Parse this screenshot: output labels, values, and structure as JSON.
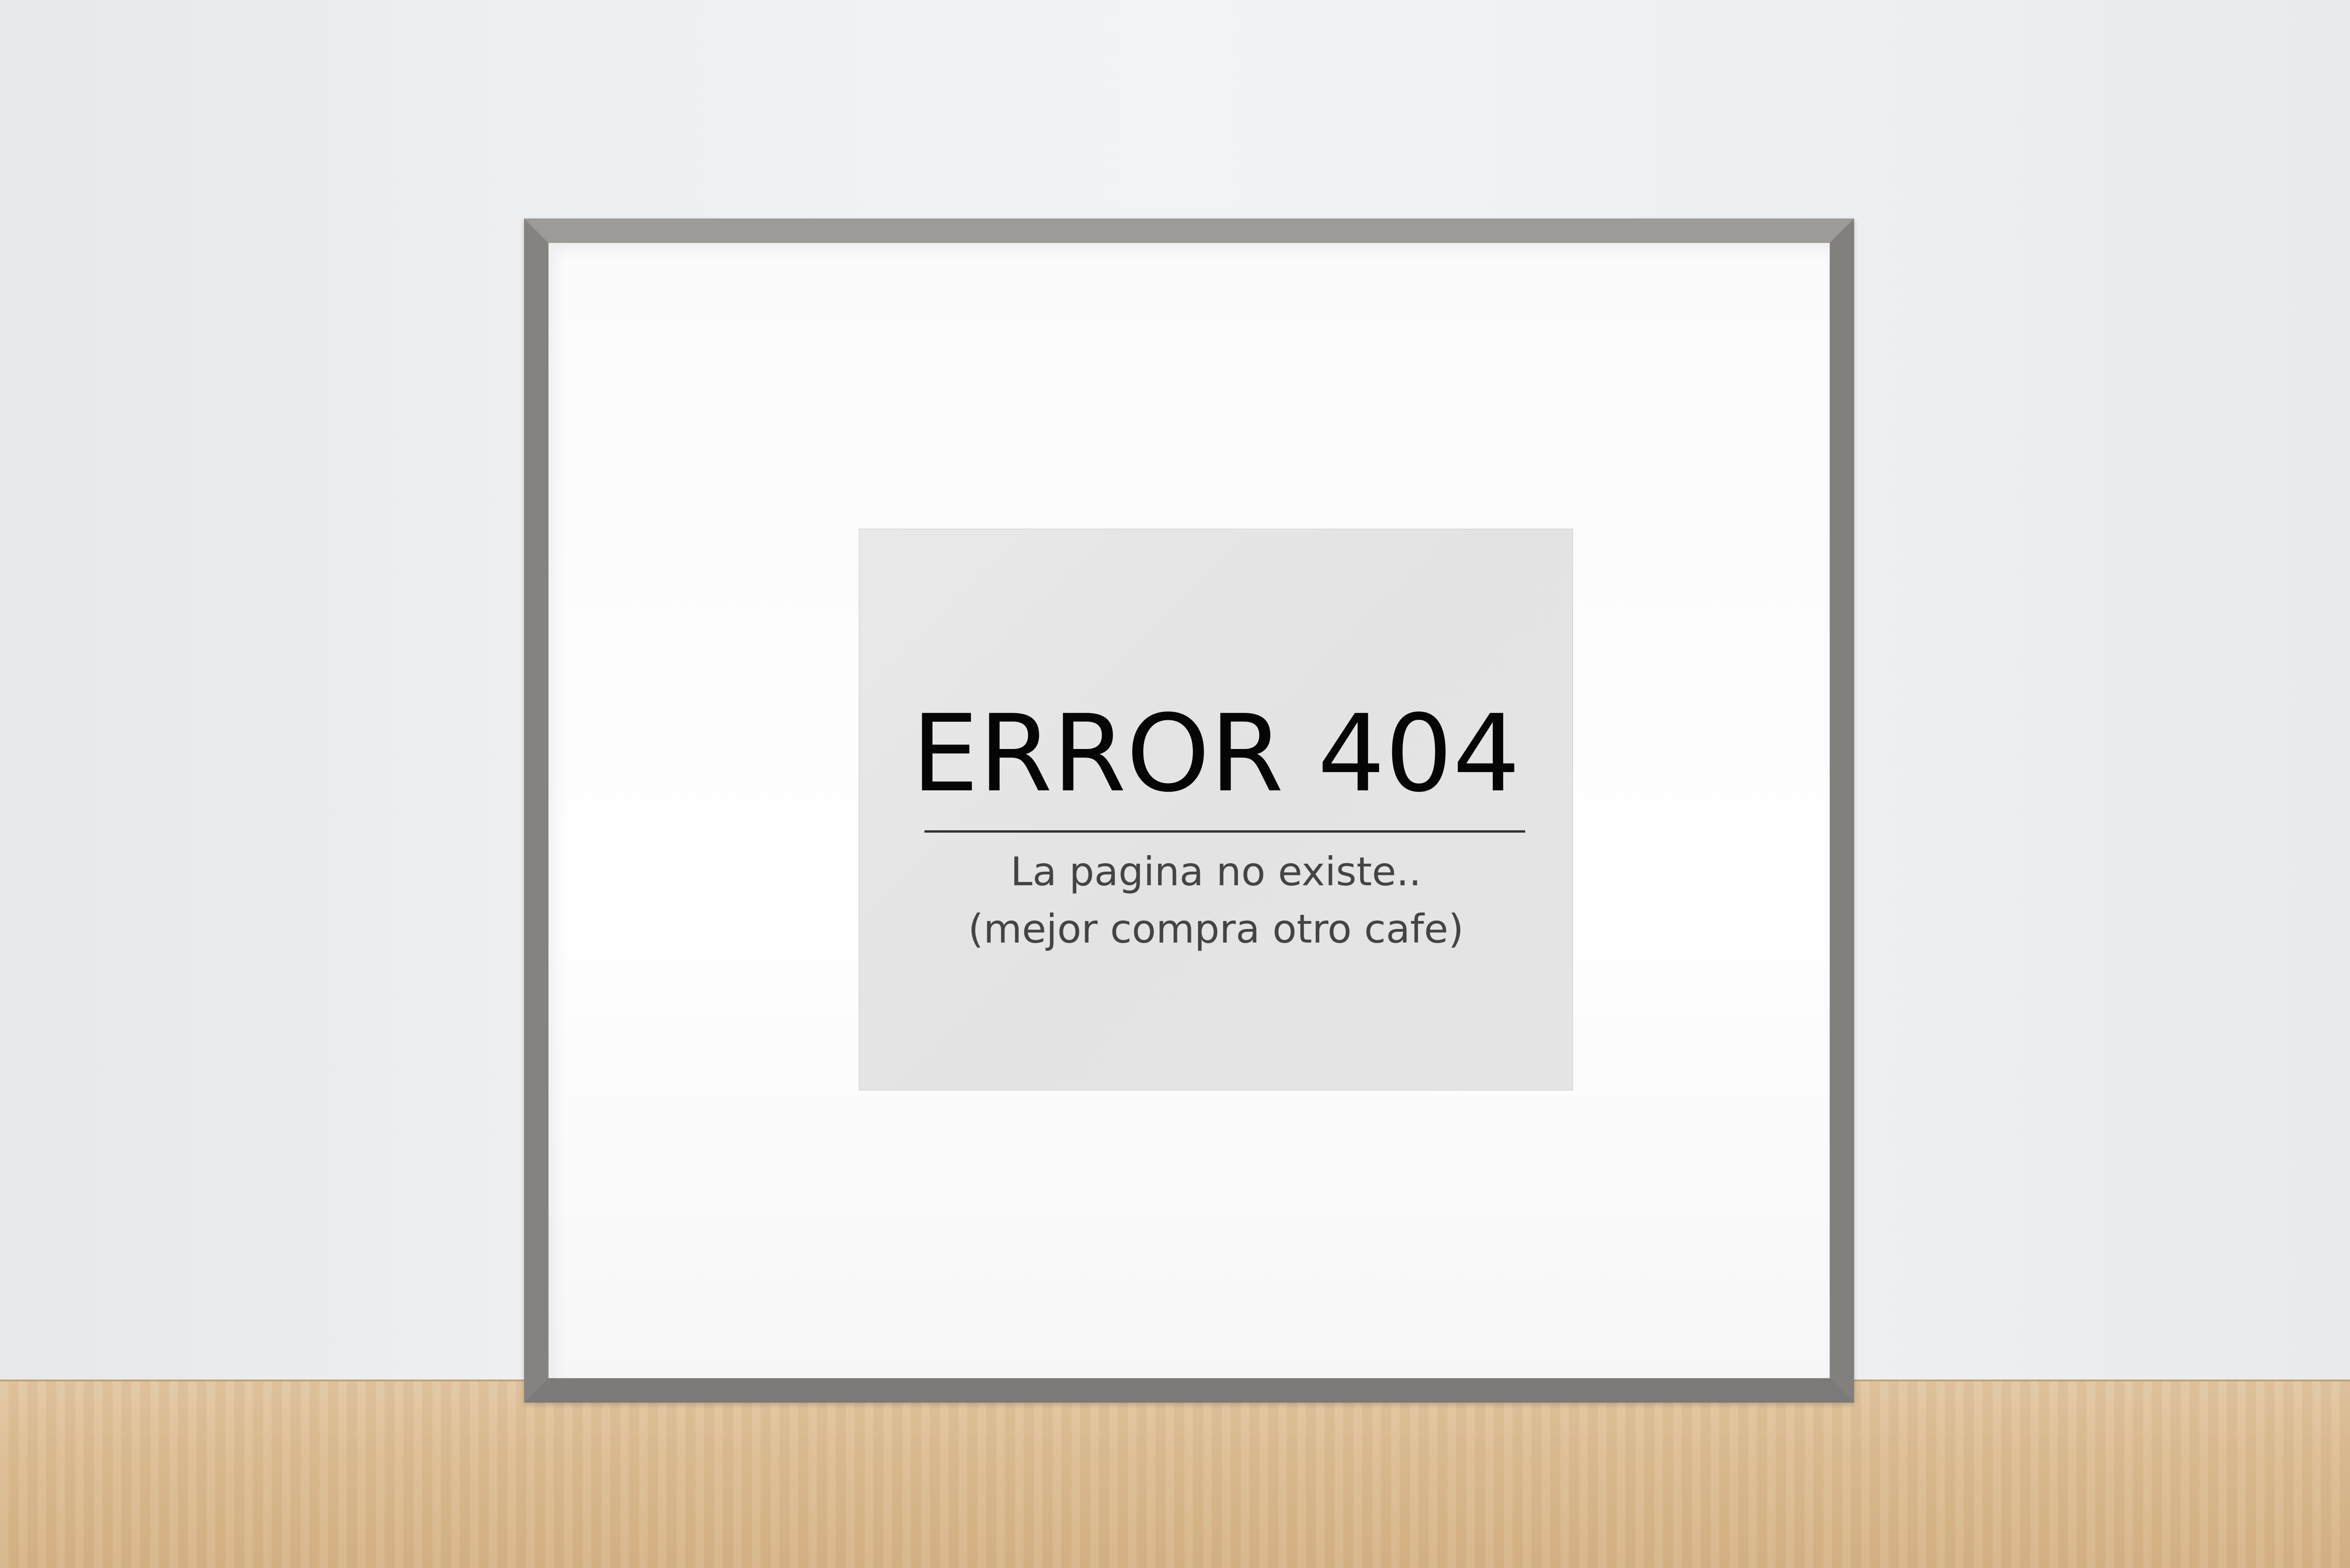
{
  "sign": {
    "title": "ERROR 404",
    "line1": "La pagina no existe..",
    "line2": "(mejor compra otro cafe)"
  },
  "colors": {
    "wall": "#eef0f2",
    "frame": "#8e8c88",
    "print": "#e6e6e6",
    "shelf": "#dcbd93"
  }
}
